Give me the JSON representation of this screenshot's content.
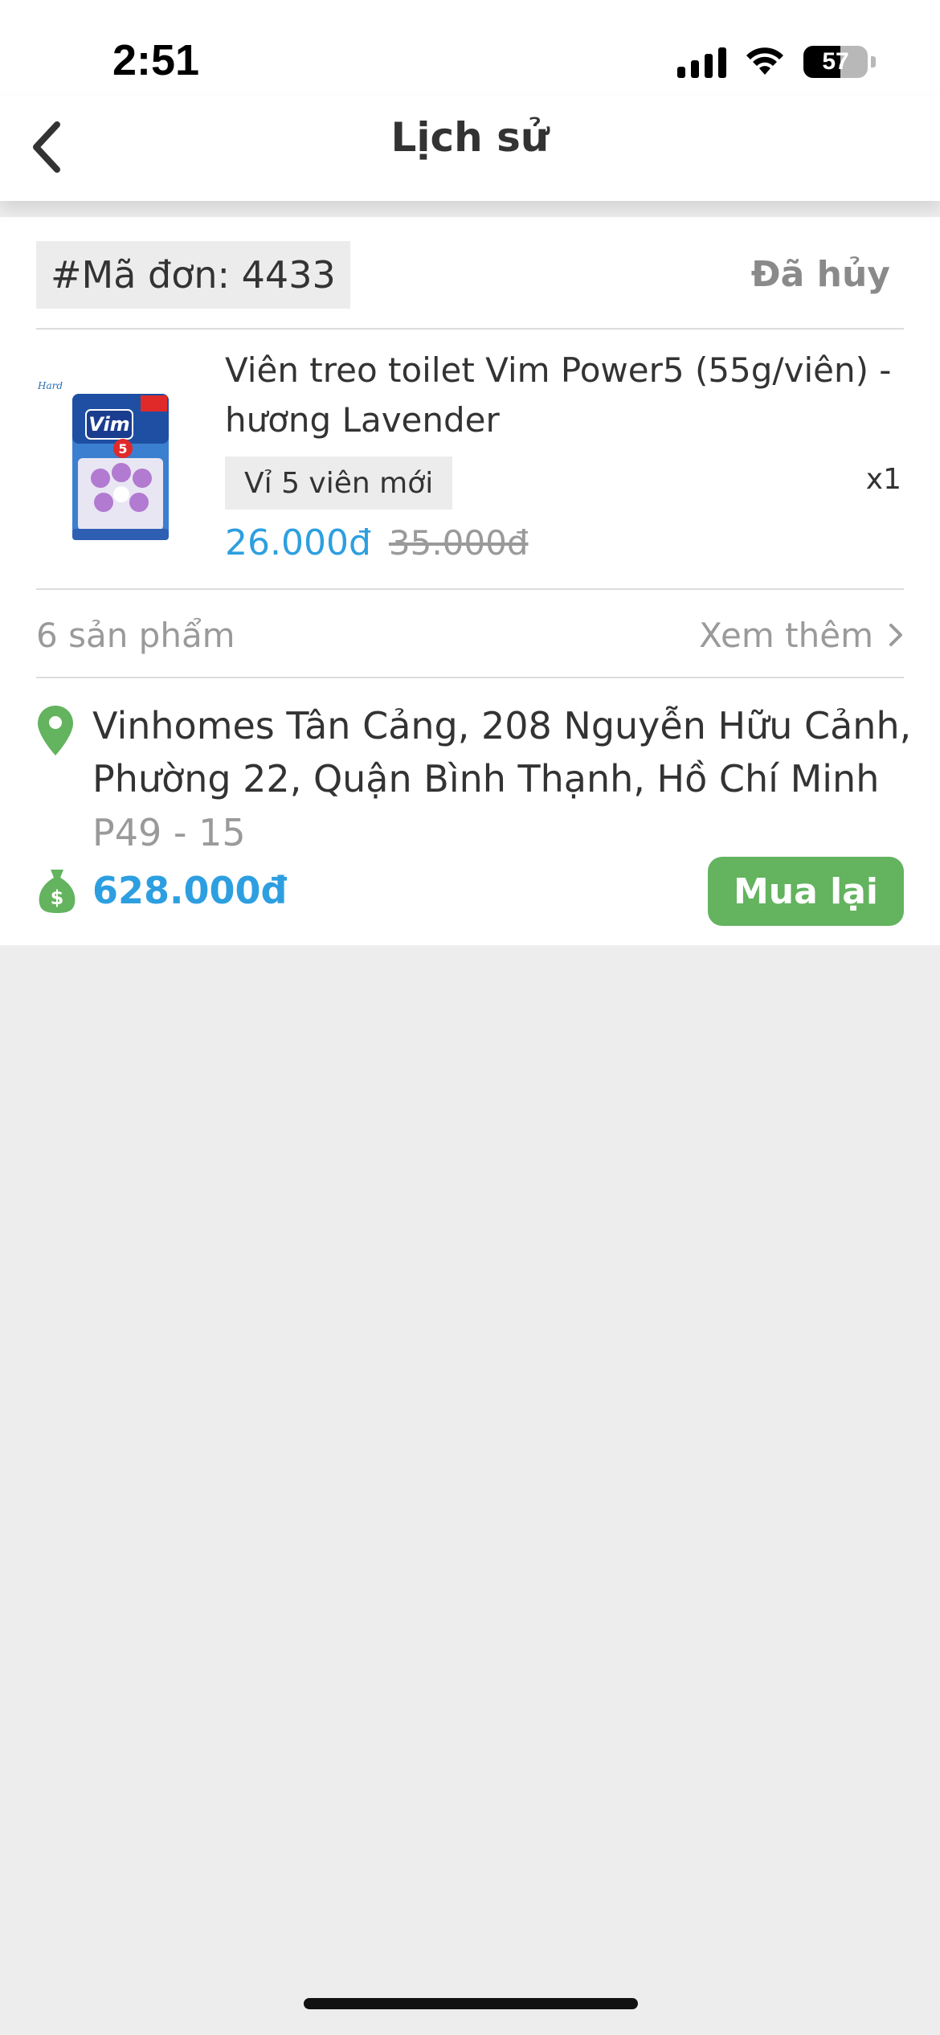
{
  "status_bar": {
    "time": "2:51",
    "battery_level": "57",
    "battery_fraction": 0.57,
    "icons": [
      "signal-icon",
      "wifi-icon",
      "battery-icon"
    ]
  },
  "nav": {
    "title": "Lịch sử",
    "back_icon": "chevron-left-icon"
  },
  "order": {
    "id_label": "#Mã đơn: 4433",
    "status": "Đã hủy",
    "product": {
      "name": "Viên treo toilet Vim Power5 (55g/viên) - hương Lavender",
      "variant": "Vỉ 5 viên mới",
      "quantity": "x1",
      "price": "26.000đ",
      "original_price": "35.000đ",
      "image_brand_text": "Vim"
    },
    "product_count": "6 sản phẩm",
    "see_more": "Xem thêm",
    "address": "Vinhomes Tân Cảng,  208 Nguyễn Hữu Cảnh, Phường 22, Quận Bình Thạnh, Hồ Chí Minh",
    "address_detail": "P49 - 15",
    "total": "628.000đ",
    "rebuy_label": "Mua lại"
  },
  "colors": {
    "accent_blue": "#2d9fe0",
    "accent_green": "#63b35f",
    "muted_text": "#9a9a9a",
    "background": "#ededed"
  }
}
